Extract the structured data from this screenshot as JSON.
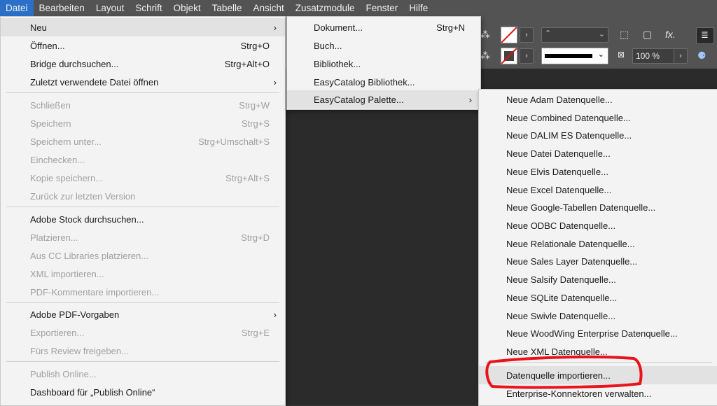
{
  "menubar": [
    "Datei",
    "Bearbeiten",
    "Layout",
    "Schrift",
    "Objekt",
    "Tabelle",
    "Ansicht",
    "Zusatzmodule",
    "Fenster",
    "Hilfe"
  ],
  "control_panel": {
    "zoom": "100 %",
    "fx_label": "fx."
  },
  "menu_datei": {
    "items": [
      {
        "label": "Neu",
        "shortcut": "",
        "submenu": true,
        "disabled": false
      },
      {
        "label": "Öffnen...",
        "shortcut": "Strg+O",
        "submenu": false,
        "disabled": false
      },
      {
        "label": "Bridge durchsuchen...",
        "shortcut": "Strg+Alt+O",
        "submenu": false,
        "disabled": false
      },
      {
        "label": "Zuletzt verwendete Datei öffnen",
        "shortcut": "",
        "submenu": true,
        "disabled": false
      },
      {
        "label": "Schließen",
        "shortcut": "Strg+W",
        "submenu": false,
        "disabled": true
      },
      {
        "label": "Speichern",
        "shortcut": "Strg+S",
        "submenu": false,
        "disabled": true
      },
      {
        "label": "Speichern unter...",
        "shortcut": "Strg+Umschalt+S",
        "submenu": false,
        "disabled": true
      },
      {
        "label": "Einchecken...",
        "shortcut": "",
        "submenu": false,
        "disabled": true
      },
      {
        "label": "Kopie speichern...",
        "shortcut": "Strg+Alt+S",
        "submenu": false,
        "disabled": true
      },
      {
        "label": "Zurück zur letzten Version",
        "shortcut": "",
        "submenu": false,
        "disabled": true
      },
      {
        "label": "Adobe Stock durchsuchen...",
        "shortcut": "",
        "submenu": false,
        "disabled": false
      },
      {
        "label": "Platzieren...",
        "shortcut": "Strg+D",
        "submenu": false,
        "disabled": true
      },
      {
        "label": "Aus CC Libraries platzieren...",
        "shortcut": "",
        "submenu": false,
        "disabled": true
      },
      {
        "label": "XML importieren...",
        "shortcut": "",
        "submenu": false,
        "disabled": true
      },
      {
        "label": "PDF-Kommentare importieren...",
        "shortcut": "",
        "submenu": false,
        "disabled": true
      },
      {
        "label": "Adobe PDF-Vorgaben",
        "shortcut": "",
        "submenu": true,
        "disabled": false
      },
      {
        "label": "Exportieren...",
        "shortcut": "Strg+E",
        "submenu": false,
        "disabled": true
      },
      {
        "label": "Fürs Review freigeben...",
        "shortcut": "",
        "submenu": false,
        "disabled": true
      },
      {
        "label": "Publish Online...",
        "shortcut": "",
        "submenu": false,
        "disabled": true
      },
      {
        "label": "Dashboard für „Publish Online“",
        "shortcut": "",
        "submenu": false,
        "disabled": false
      }
    ]
  },
  "menu_neu": {
    "items": [
      {
        "label": "Dokument...",
        "shortcut": "Strg+N",
        "submenu": false
      },
      {
        "label": "Buch...",
        "shortcut": "",
        "submenu": false
      },
      {
        "label": "Bibliothek...",
        "shortcut": "",
        "submenu": false
      },
      {
        "label": "EasyCatalog Bibliothek...",
        "shortcut": "",
        "submenu": false
      },
      {
        "label": "EasyCatalog Palette...",
        "shortcut": "",
        "submenu": true
      }
    ]
  },
  "menu_palette": {
    "items": [
      "Neue Adam Datenquelle...",
      "Neue Combined Datenquelle...",
      "Neue DALIM ES Datenquelle...",
      "Neue Datei Datenquelle...",
      "Neue Elvis Datenquelle...",
      "Neue Excel Datenquelle...",
      "Neue Google-Tabellen Datenquelle...",
      "Neue ODBC Datenquelle...",
      "Neue Relationale Datenquelle...",
      "Neue Sales Layer Datenquelle...",
      "Neue Salsify Datenquelle...",
      "Neue SQLite Datenquelle...",
      "Neue Swivle Datenquelle...",
      "Neue WoodWing Enterprise Datenquelle...",
      "Neue XML Datenquelle...",
      "Datenquelle importieren...",
      "Enterprise-Konnektoren verwalten..."
    ]
  },
  "colors": {
    "annotation_red": "#e8141c",
    "highlight": "#2a70c9"
  }
}
